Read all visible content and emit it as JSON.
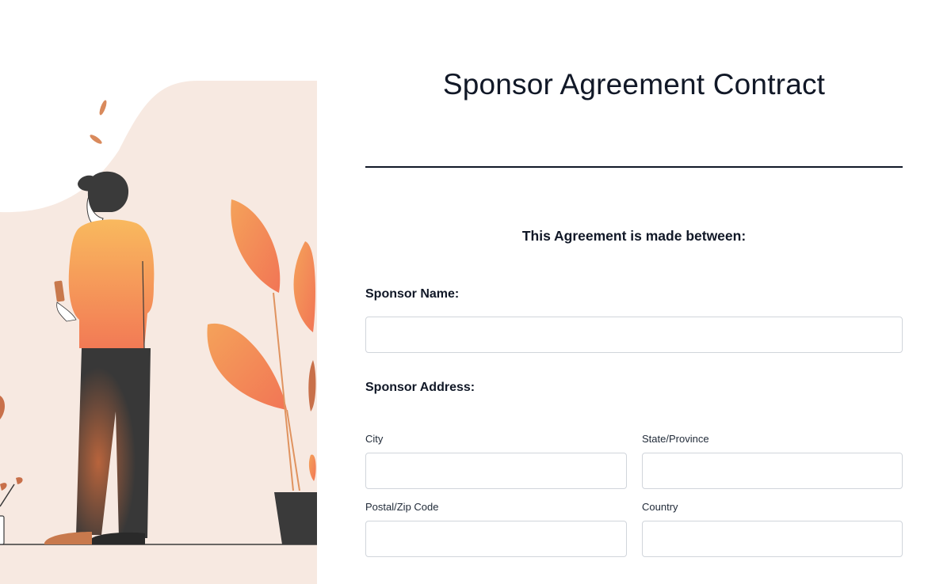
{
  "form": {
    "title": "Sponsor Agreement Contract",
    "intro": "This Agreement is made between:",
    "sponsor_name": {
      "label": "Sponsor Name:",
      "value": "",
      "placeholder": ""
    },
    "sponsor_address": {
      "label": "Sponsor Address:",
      "city": {
        "label": "City",
        "value": "",
        "placeholder": ""
      },
      "state": {
        "label": "State/Province",
        "value": "",
        "placeholder": ""
      },
      "postal": {
        "label": "Postal/Zip Code",
        "value": "",
        "placeholder": ""
      },
      "country": {
        "label": "Country",
        "value": "",
        "placeholder": ""
      }
    }
  },
  "colors": {
    "illustration_bg": "#f7e9e1",
    "accent_orange": "#f4875a",
    "accent_yellow": "#f9b45c",
    "dark": "#3a3a3a",
    "text": "#111827",
    "input_border": "#d1d5db"
  }
}
